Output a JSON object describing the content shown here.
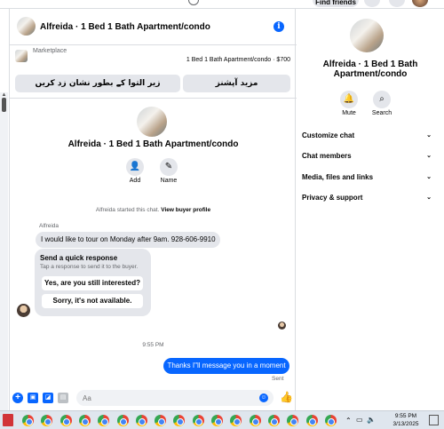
{
  "topbar": {
    "find_friends_label": "Find friends"
  },
  "chat": {
    "title": "Alfreida · 1 Bed 1 Bath Apartment/condo",
    "marketplace_label": "Marketplace",
    "listing_price": "1 Bed 1 Bath Apartment/condo · $700",
    "buttons": [
      "زیر التوا کے بطور نشان زد کریں",
      "مزید آپشنز"
    ],
    "profile_name": "Alfreida · 1 Bed 1 Bath Apartment/condo",
    "actions": [
      {
        "label": "Add",
        "icon": "add-person-icon"
      },
      {
        "label": "Name",
        "icon": "pencil-icon"
      }
    ],
    "system_message": "Alfreida started this chat.",
    "system_link": "View buyer profile",
    "sender": "Alfreida",
    "incoming_message": "I would like to tour on Monday after 9am. 928-606-9910",
    "quick_response": {
      "title": "Send a quick response",
      "subtitle": "Tap a response to send it to the buyer.",
      "options": [
        "Yes, are you still interested?",
        "Sorry, it's not available."
      ]
    },
    "timestamp": "9:55 PM",
    "outgoing_message": "Thanks I\"ll message you in a moment",
    "sent_status": "Sent",
    "composer_placeholder": "Aa"
  },
  "sidebar": {
    "name": "Alfreida · 1 Bed 1 Bath Apartment/condo",
    "actions": [
      {
        "label": "Mute",
        "icon": "bell-icon"
      },
      {
        "label": "Search",
        "icon": "search-icon"
      }
    ],
    "sections": [
      "Customize chat",
      "Chat members",
      "Media, files and links",
      "Privacy & support"
    ]
  },
  "taskbar": {
    "time": "9:55 PM",
    "date": "3/13/2025",
    "chrome_count": 17
  },
  "colors": {
    "accent": "#0866ff",
    "bubble_gray": "#e4e6eb",
    "taskbar": "#dfe6ee"
  }
}
